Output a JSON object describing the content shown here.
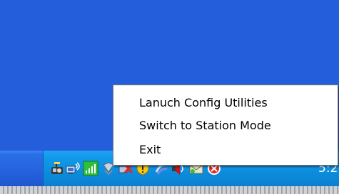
{
  "context_menu": {
    "items": [
      {
        "label": "Lanuch Config Utilities"
      },
      {
        "label": "Switch to Station Mode"
      },
      {
        "label": "Exit"
      }
    ]
  },
  "taskbar": {
    "clock_text": "5:2",
    "tray_icons": [
      "wireless-utility-icon",
      "wireless-network-icon",
      "signal-strength-icon",
      "network-shield-icon",
      "firewall-icon",
      "security-alert-icon",
      "bluetooth-icon",
      "speaker-icon",
      "mail-icon",
      "antivirus-icon"
    ]
  },
  "colors": {
    "desktop": "#245edb",
    "taskbar": "#2563df",
    "tray": "#0d8ddd",
    "menu_background": "#ffffff",
    "menu_text": "#000000"
  }
}
